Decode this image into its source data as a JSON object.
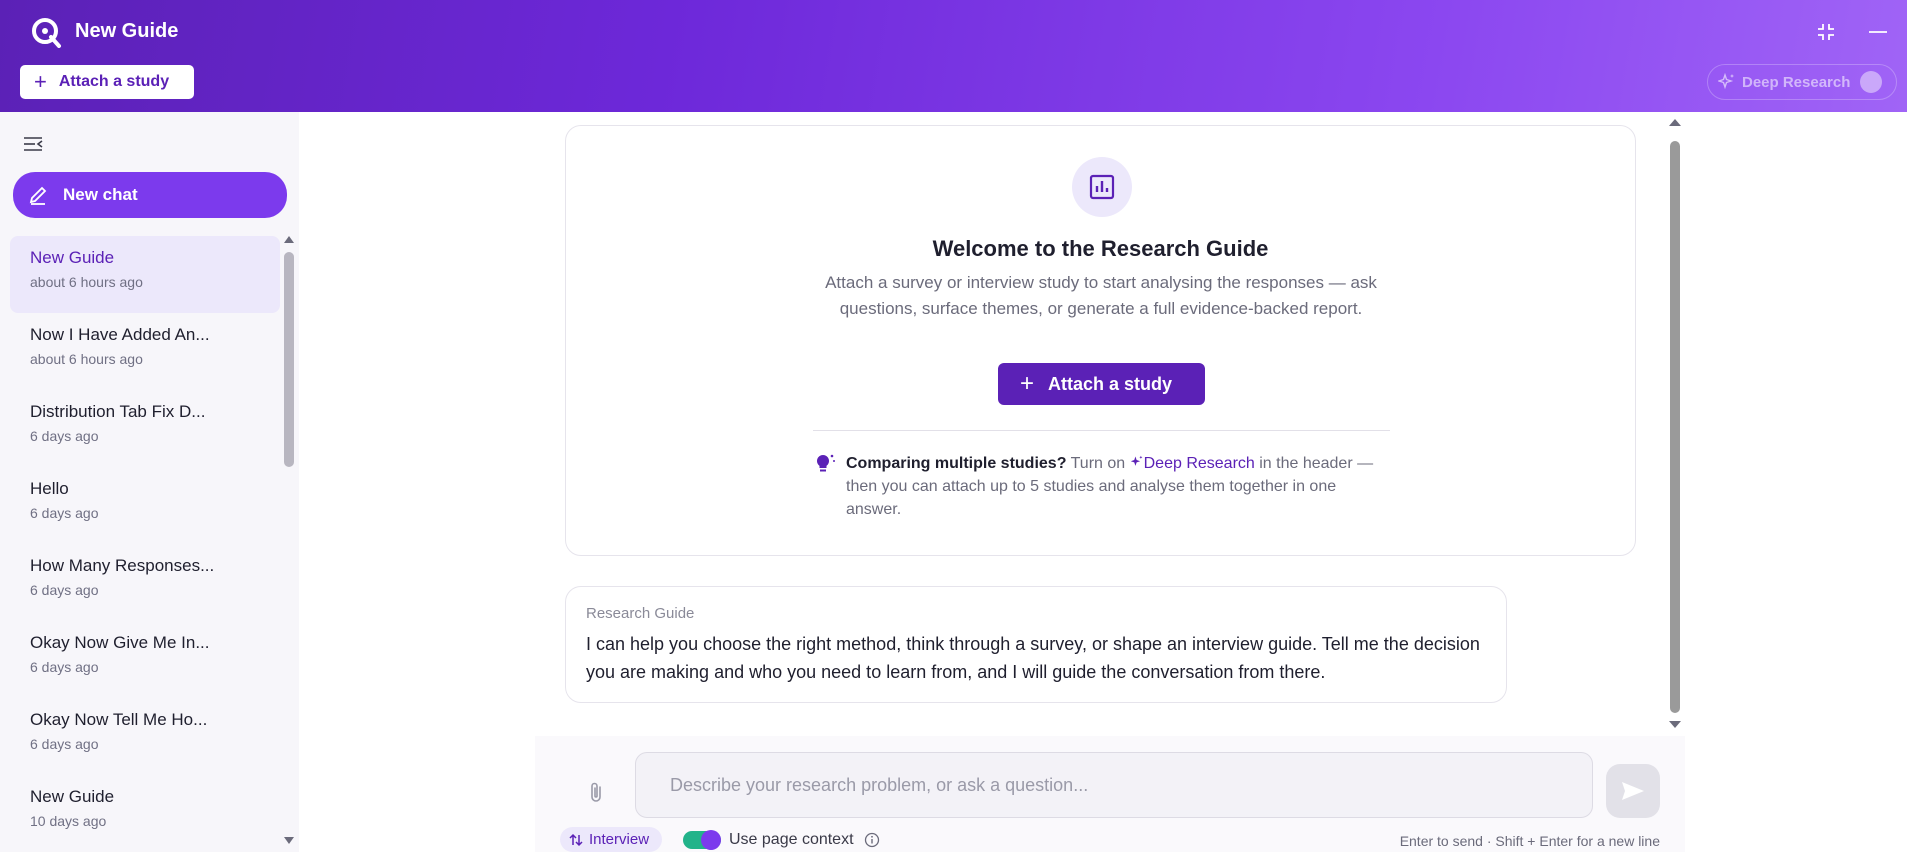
{
  "header": {
    "title": "New Guide",
    "attach_label": "Attach a study",
    "deep_research_label": "Deep Research"
  },
  "sidebar": {
    "new_chat_label": "New chat",
    "chats": [
      {
        "title": "New Guide",
        "time": "about 6 hours ago",
        "active": true
      },
      {
        "title": "Now I Have Added An...",
        "time": "about 6 hours ago"
      },
      {
        "title": "Distribution Tab Fix D...",
        "time": "6 days ago"
      },
      {
        "title": "Hello",
        "time": "6 days ago"
      },
      {
        "title": "How Many Responses...",
        "time": "6 days ago"
      },
      {
        "title": "Okay Now Give Me In...",
        "time": "6 days ago"
      },
      {
        "title": "Okay Now Tell Me Ho...",
        "time": "6 days ago"
      },
      {
        "title": "New Guide",
        "time": "10 days ago"
      }
    ]
  },
  "welcome": {
    "title": "Welcome to the Research Guide",
    "description": "Attach a survey or interview study to start analysing the responses — ask questions, surface themes, or generate a full evidence-backed report.",
    "attach_label": "Attach a study",
    "tip_strong": "Comparing multiple studies?",
    "tip_pre": "Turn on",
    "tip_deep": "Deep Research",
    "tip_post": "in the header — then you can attach up to 5 studies and analyse them together in one answer."
  },
  "message": {
    "sender": "Research Guide",
    "text": "I can help you choose the right method, think through a survey, or shape an interview guide. Tell me the decision you are making and who you need to learn from, and I will guide the conversation from there."
  },
  "composer": {
    "placeholder": "Describe your research problem, or ask a question...",
    "mode_label": "Interview",
    "context_label": "Use page context",
    "context_enabled": true,
    "hint": "Enter to send · Shift + Enter for a new line"
  },
  "colors": {
    "brand": "#5b21b6",
    "accent": "#7c3aed",
    "toggle_on": "#22b38a"
  },
  "icons": [
    "app-logo-icon",
    "minimize-window-icon",
    "collapse-sidebar-icon",
    "edit-icon",
    "chart-icon",
    "lightbulb-icon",
    "sparkle-icon",
    "paperclip-icon",
    "send-icon",
    "info-icon",
    "swap-icon"
  ]
}
